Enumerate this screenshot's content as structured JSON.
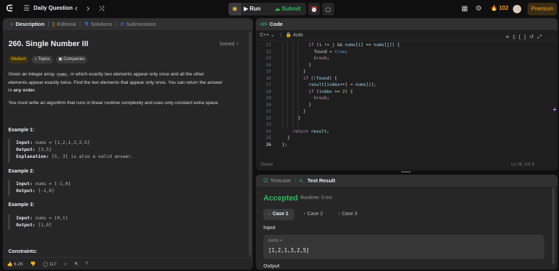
{
  "topbar": {
    "logo_glyph": "ᕮ",
    "list_icon": "☰",
    "title": "Daily Question",
    "prev_icon": "‹",
    "next_icon": "›",
    "shuffle_icon": "⤨",
    "run_label": "Run",
    "submit_label": "Submit",
    "alarm_icon": "⏰",
    "note_icon": "▢",
    "grid_icon": "▦",
    "settings_icon": "⚙",
    "streak_count": "102",
    "premium_label": "Premium"
  },
  "left_panel": {
    "tabs": [
      {
        "label": "Description",
        "icon": "≡"
      },
      {
        "label": "Editorial",
        "icon": "▯"
      },
      {
        "label": "Solutions",
        "icon": "⚗"
      },
      {
        "label": "Submissions",
        "icon": "↺"
      }
    ],
    "title": "260. Single Number III",
    "solved_label": "Solved",
    "chips": {
      "difficulty": "Medium",
      "topics": "Topics",
      "companies": "Companies"
    },
    "desc1_pre": "Given an integer array ",
    "desc1_code": "nums",
    "desc1_post": ", in which exactly two elements appear only once and all the other",
    "desc2": "elements appear exactly twice. Find the two elements that appear only once. You can return the answer",
    "desc3_pre": "in ",
    "desc3_bold": "any order",
    "desc3_post": ".",
    "desc4": "You must write an algorithm that runs in linear runtime complexity and uses only constant extra space.",
    "examples": [
      {
        "heading": "Example 1:",
        "input_label": "Input:",
        "input": "nums = [1,2,1,3,2,5]",
        "output_label": "Output:",
        "output": "[3,5]",
        "expl_label": "Explanation:",
        "expl": "[5, 3] is also a valid answer."
      },
      {
        "heading": "Example 2:",
        "input_label": "Input:",
        "input": "nums = [-1,0]",
        "output_label": "Output:",
        "output": "[-1,0]"
      },
      {
        "heading": "Example 3:",
        "input_label": "Input:",
        "input": "nums = [0,1]",
        "output_label": "Output:",
        "output": "[1,0]"
      }
    ],
    "constraints_heading": "Constraints:",
    "footer": {
      "likes": "6.2K",
      "comments": "117"
    }
  },
  "code_panel": {
    "title": "Code",
    "language": "C++",
    "mode": "Auto",
    "status_left": "Saved",
    "status_right": "Ln 26, Col 3",
    "line_numbers": [
      "11",
      "12",
      "13",
      "14",
      "15",
      "16",
      "17",
      "18",
      "19",
      "20",
      "21",
      "22",
      "23",
      "24",
      "25",
      "26"
    ]
  },
  "test_panel": {
    "tab_testcase": "Testcase",
    "tab_result": "Test Result",
    "verdict": "Accepted",
    "runtime": "Runtime: 0 ms",
    "cases": [
      "Case 1",
      "Case 2",
      "Case 3"
    ],
    "input_label": "Input",
    "param_name": "nums =",
    "param_value": "[1,2,1,3,2,5]",
    "output_label": "Output"
  }
}
